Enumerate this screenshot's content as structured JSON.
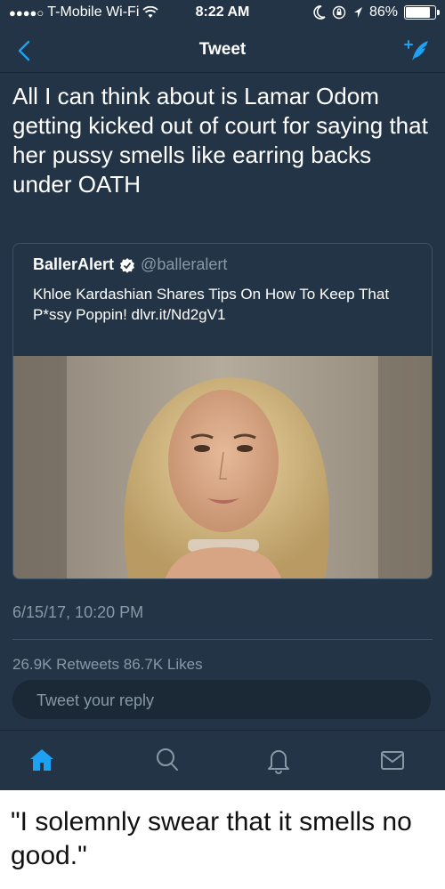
{
  "status_bar": {
    "carrier": "T-Mobile Wi-Fi",
    "time": "8:22 AM",
    "battery_percent": "86%",
    "battery_level": 0.86
  },
  "nav": {
    "title": "Tweet"
  },
  "tweet": {
    "text": "All I can think about is Lamar Odom getting kicked out of court for saying that her pussy smells like earring backs under OATH",
    "date": "6/15/17, 10:20 PM",
    "stats": "26.9K Retweets  86.7K Likes"
  },
  "quoted_tweet": {
    "author_name": "BallerAlert",
    "handle": "@balleralert",
    "text": "Khloe Kardashian Shares Tips On How To Keep That P*ssy Poppin! dlvr.it/Nd2gV1"
  },
  "reply": {
    "placeholder": "Tweet your reply"
  },
  "tab_bar": {
    "items": [
      "home-icon",
      "search-icon",
      "notifications-icon",
      "messages-icon"
    ],
    "active": "home-icon"
  },
  "caption": "\"I solemnly swear that it smells no good.\"",
  "colors": {
    "background": "#243447",
    "accent": "#1da1f2",
    "secondary_text": "#8899a6"
  }
}
